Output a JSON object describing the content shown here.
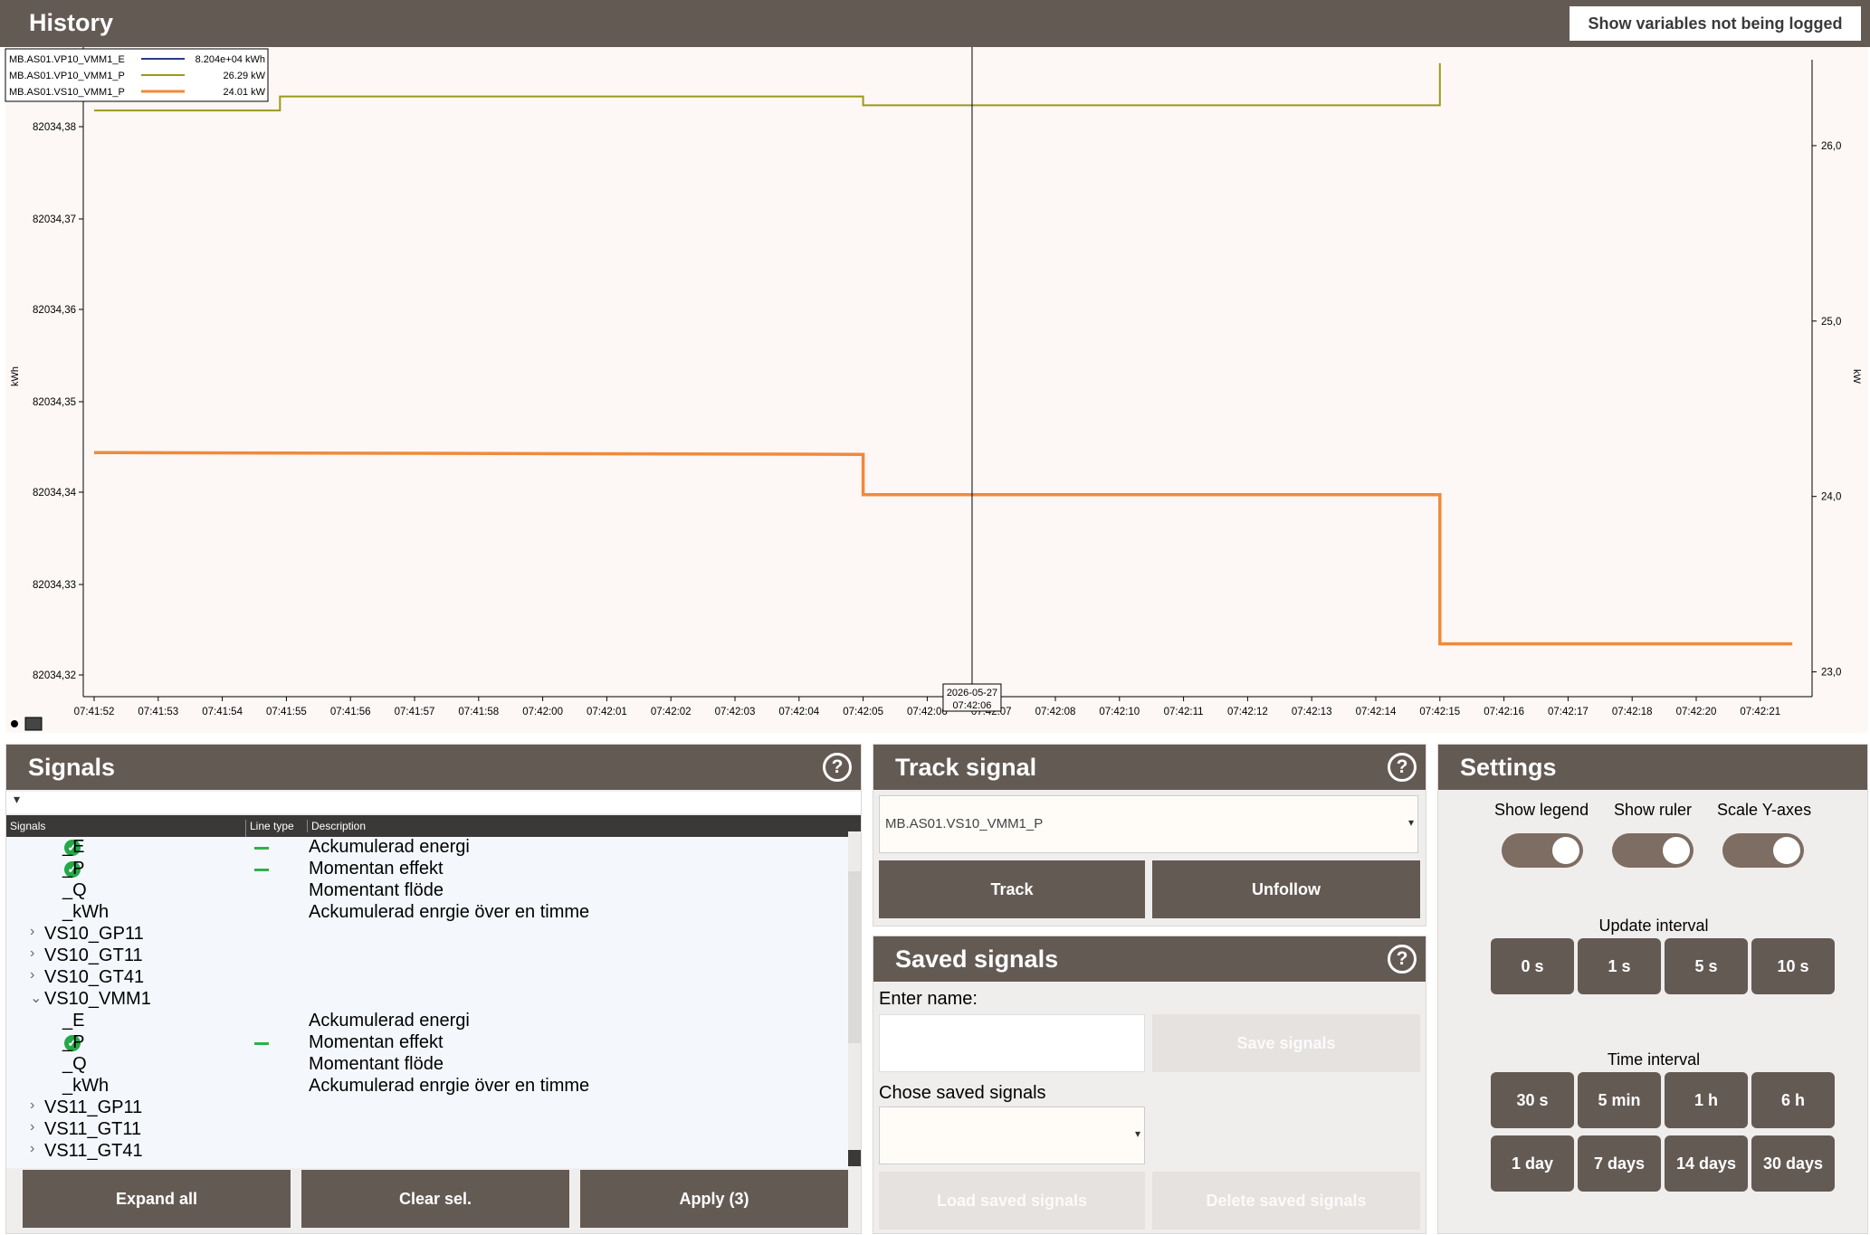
{
  "header": {
    "title": "History",
    "show_not_logged": "Show variables not being logged"
  },
  "chart": {
    "legend": [
      {
        "name": "MB.AS01.VP10_VMM1_E",
        "value": "8.204e+04 kWh",
        "color": "#2a3a8c"
      },
      {
        "name": "MB.AS01.VP10_VMM1_P",
        "value": "26.29 kW",
        "color": "#9a9a1a"
      },
      {
        "name": "MB.AS01.VS10_VMM1_P",
        "value": "24.01 kW",
        "color": "#f08a3a"
      }
    ],
    "left_unit": "kWh",
    "right_unit": "kW",
    "ruler_date": "2026-05-27",
    "ruler_time": "07:42:06"
  },
  "chart_data": {
    "type": "line",
    "x_ticks": [
      "07:41:52",
      "07:41:53",
      "07:41:54",
      "07:41:55",
      "07:41:56",
      "07:41:57",
      "07:41:58",
      "07:42:00",
      "07:42:01",
      "07:42:02",
      "07:42:03",
      "07:42:04",
      "07:42:05",
      "07:42:06",
      "07:42:07",
      "07:42:08",
      "07:42:10",
      "07:42:11",
      "07:42:12",
      "07:42:13",
      "07:42:14",
      "07:42:15",
      "07:42:16",
      "07:42:17",
      "07:42:18",
      "07:42:20",
      "07:42:21"
    ],
    "ylabel_left": "kWh",
    "ylabel_right": "kW",
    "y_left_ticks": [
      "82034,38",
      "82034,37",
      "82034,36",
      "82034,35",
      "82034,34",
      "82034,33",
      "82034,32"
    ],
    "y_right_ticks": [
      "26,0",
      "25,0",
      "24,0",
      "23,0"
    ],
    "ylim_right": [
      22.9,
      26.5
    ],
    "series": [
      {
        "name": "MB.AS01.VP10_VMM1_P",
        "color": "#9a9a1a",
        "width": 2,
        "points": [
          [
            0,
            26.2
          ],
          [
            2.9,
            26.2
          ],
          [
            2.9,
            26.28
          ],
          [
            12,
            26.28
          ],
          [
            12,
            26.23
          ],
          [
            21,
            26.23
          ],
          [
            21,
            26.47
          ]
        ]
      },
      {
        "name": "MB.AS01.VS10_VMM1_P",
        "color": "#f08a3a",
        "width": 3.5,
        "points": [
          [
            0,
            24.25
          ],
          [
            12,
            24.24
          ],
          [
            12,
            24.01
          ],
          [
            21,
            24.01
          ],
          [
            21,
            23.16
          ],
          [
            26.5,
            23.16
          ]
        ]
      }
    ],
    "ruler_x": 13.7
  },
  "signals": {
    "title": "Signals",
    "help": "?",
    "columns": [
      "Signals",
      "Line type",
      "Description"
    ],
    "rows": [
      {
        "name": "_E",
        "indent": 2,
        "checked": true,
        "line": true,
        "desc": "Ackumulerad energi"
      },
      {
        "name": "_P",
        "indent": 2,
        "checked": true,
        "line": true,
        "desc": "Momentan effekt"
      },
      {
        "name": "_Q",
        "indent": 2,
        "checked": false,
        "line": false,
        "desc": "Momentant flöde"
      },
      {
        "name": "_kWh",
        "indent": 2,
        "checked": false,
        "line": false,
        "desc": "Ackumulerad enrgie över en timme"
      },
      {
        "name": "VS10_GP11",
        "indent": 1,
        "caret": "›",
        "desc": ""
      },
      {
        "name": "VS10_GT11",
        "indent": 1,
        "caret": "›",
        "desc": ""
      },
      {
        "name": "VS10_GT41",
        "indent": 1,
        "caret": "›",
        "desc": ""
      },
      {
        "name": "VS10_VMM1",
        "indent": 1,
        "caret": "⌄",
        "desc": ""
      },
      {
        "name": "_E",
        "indent": 2,
        "checked": false,
        "line": false,
        "desc": "Ackumulerad energi"
      },
      {
        "name": "_P",
        "indent": 2,
        "checked": true,
        "line": true,
        "desc": "Momentan effekt"
      },
      {
        "name": "_Q",
        "indent": 2,
        "checked": false,
        "line": false,
        "desc": "Momentant flöde"
      },
      {
        "name": "_kWh",
        "indent": 2,
        "checked": false,
        "line": false,
        "desc": "Ackumulerad enrgie över en timme"
      },
      {
        "name": "VS11_GP11",
        "indent": 1,
        "caret": "›",
        "desc": ""
      },
      {
        "name": "VS11_GT11",
        "indent": 1,
        "caret": "›",
        "desc": ""
      },
      {
        "name": "VS11_GT41",
        "indent": 1,
        "caret": "›",
        "desc": ""
      }
    ],
    "expand_all": "Expand all",
    "clear_sel": "Clear sel.",
    "apply": "Apply (3)"
  },
  "track": {
    "title": "Track signal",
    "help": "?",
    "selected": "MB.AS01.VS10_VMM1_P",
    "track_btn": "Track",
    "unfollow_btn": "Unfollow"
  },
  "saved": {
    "title": "Saved signals",
    "help": "?",
    "enter_name": "Enter name:",
    "save_btn": "Save signals",
    "chose_label": "Chose saved signals",
    "load_btn": "Load saved signals",
    "delete_btn": "Delete saved signals"
  },
  "settings": {
    "title": "Settings",
    "show_legend": "Show legend",
    "show_ruler": "Show ruler",
    "scale_y": "Scale Y-axes",
    "update_interval": "Update interval",
    "update_options": [
      "0 s",
      "1 s",
      "5 s",
      "10 s"
    ],
    "time_interval": "Time interval",
    "time_options": [
      "30 s",
      "5 min",
      "1 h",
      "6 h",
      "1 day",
      "7 days",
      "14 days",
      "30 days"
    ]
  }
}
